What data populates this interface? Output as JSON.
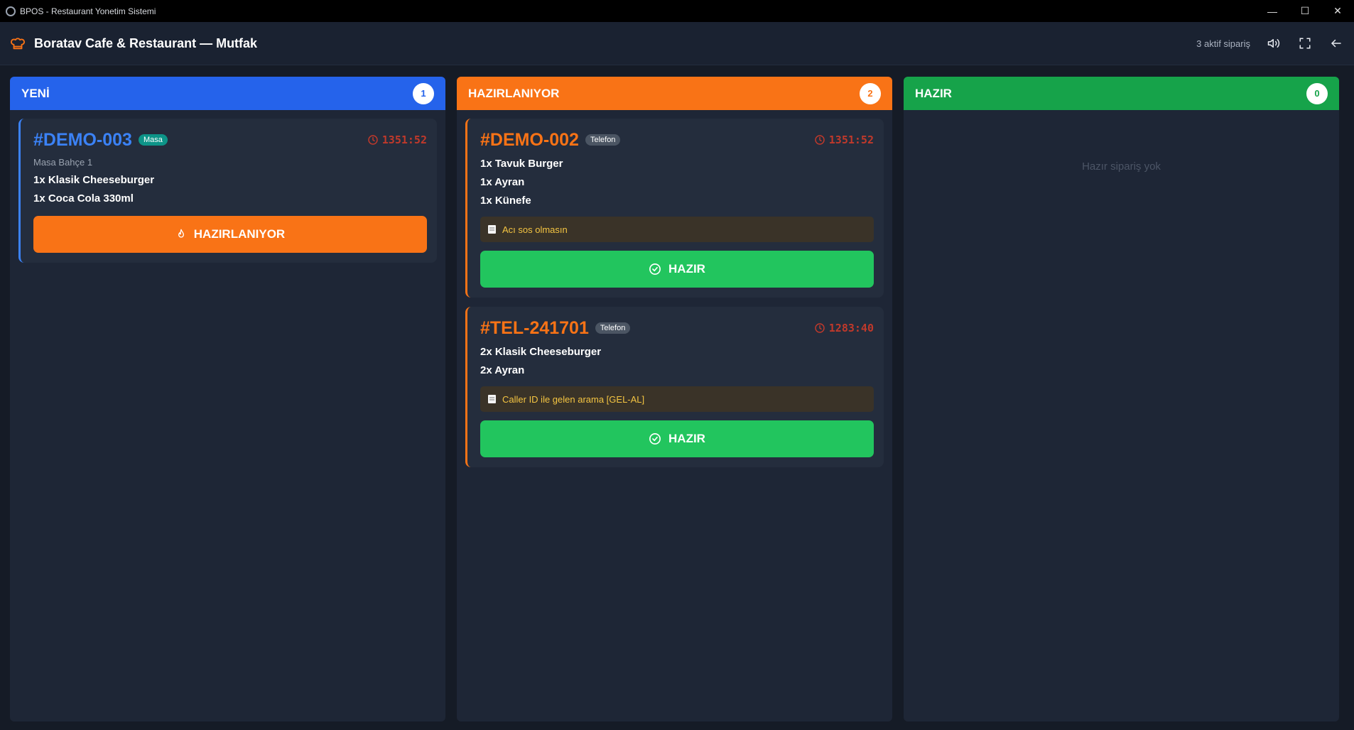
{
  "window": {
    "title": "BPOS - Restaurant Yonetim Sistemi"
  },
  "header": {
    "title": "Boratav Cafe & Restaurant — Mutfak",
    "active_count": "3 aktif sipariş"
  },
  "colors": {
    "new": "#2563eb",
    "preparing": "#f97316",
    "ready": "#16a34a"
  },
  "columns": {
    "new": {
      "title": "YENİ",
      "count": "1",
      "orders": [
        {
          "no": "#DEMO-003",
          "tag": "Masa",
          "timer": "1351:52",
          "table": "Masa Bahçe 1",
          "items": [
            "1x Klasik Cheeseburger",
            "1x Coca Cola 330ml"
          ],
          "action": "HAZIRLANIYOR"
        }
      ]
    },
    "preparing": {
      "title": "HAZIRLANIYOR",
      "count": "2",
      "orders": [
        {
          "no": "#DEMO-002",
          "tag": "Telefon",
          "timer": "1351:52",
          "items": [
            "1x Tavuk Burger",
            "1x Ayran",
            "1x Künefe"
          ],
          "note": "Acı sos olmasın",
          "action": "HAZIR"
        },
        {
          "no": "#TEL-241701",
          "tag": "Telefon",
          "timer": "1283:40",
          "items": [
            "2x Klasik Cheeseburger",
            "2x Ayran"
          ],
          "note": "Caller ID ile gelen arama [GEL-AL]",
          "action": "HAZIR"
        }
      ]
    },
    "ready": {
      "title": "HAZIR",
      "count": "0",
      "empty": "Hazır sipariş yok"
    }
  }
}
